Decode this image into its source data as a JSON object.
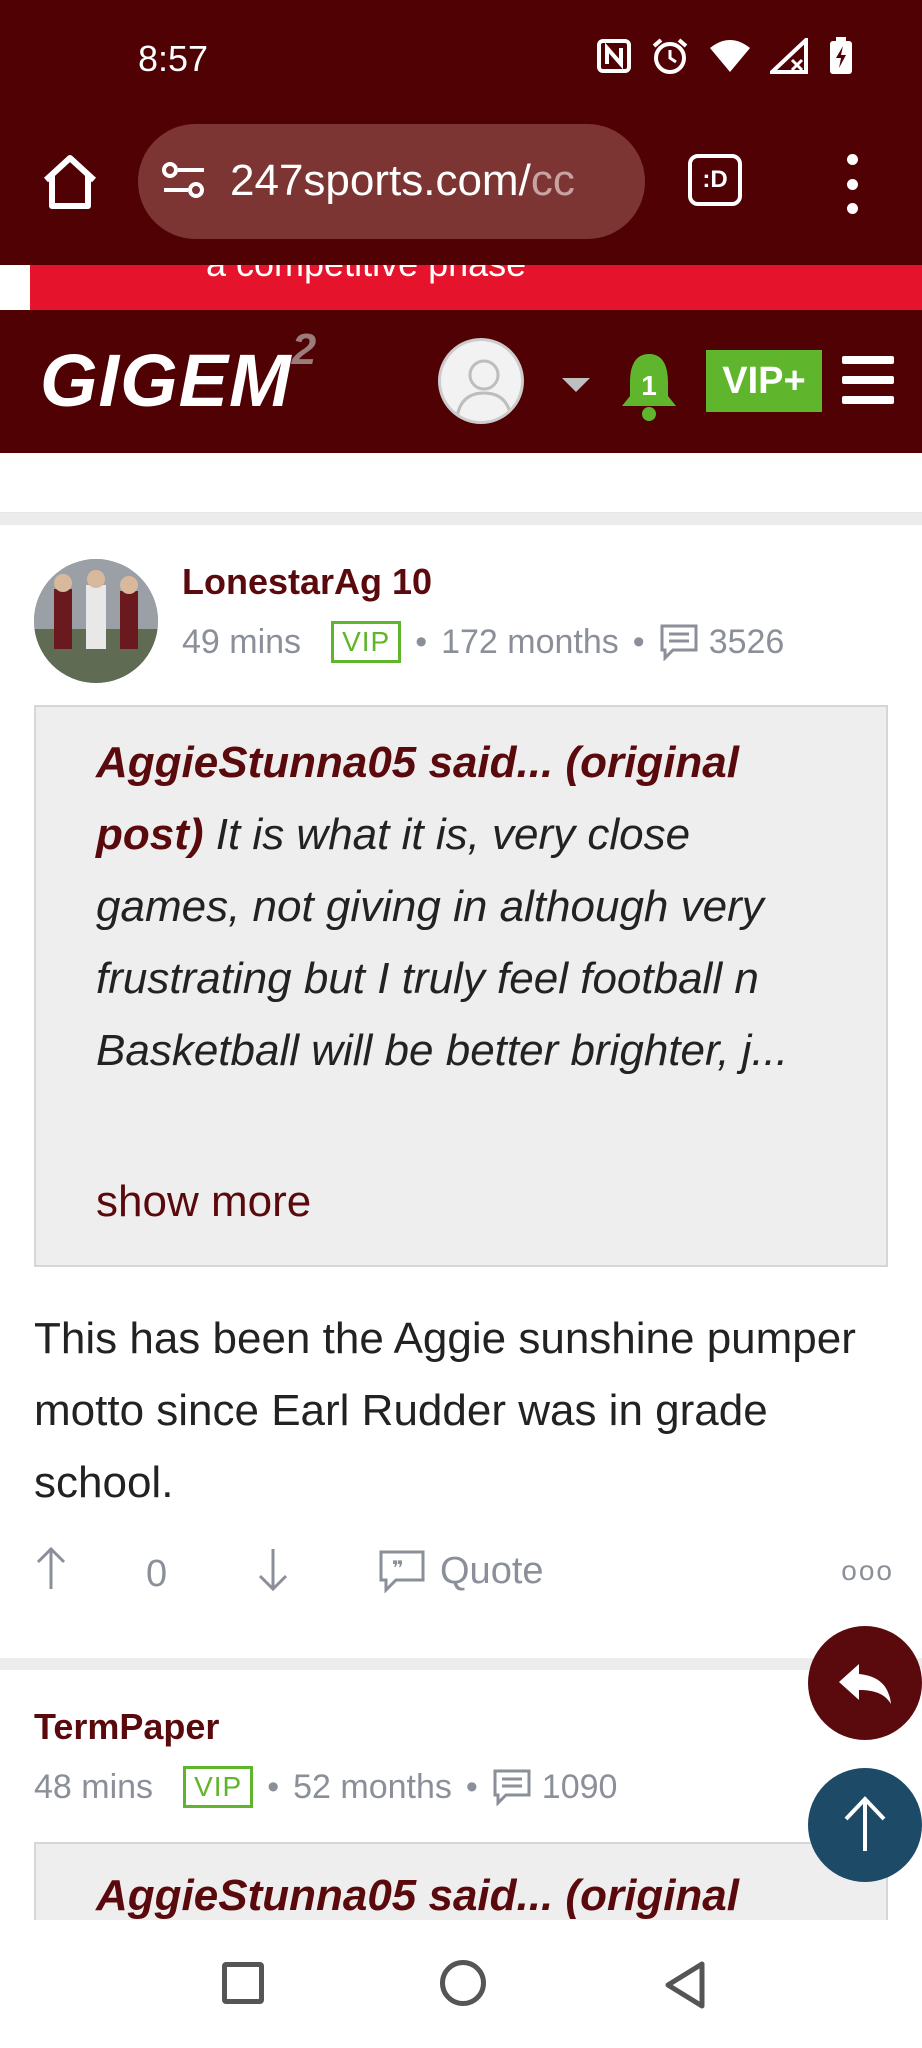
{
  "status_bar": {
    "time": "8:57"
  },
  "browser": {
    "url_main": "247sports.com/",
    "url_fade": "cc",
    "tab_label": ":D"
  },
  "promo": {
    "text": "a competitive phase"
  },
  "site_header": {
    "logo_text": "GIGEM",
    "logo_super": "2",
    "notification_count": "1",
    "vip_label": "VIP+"
  },
  "post": {
    "username": "LonestarAg 10",
    "time": "49 mins",
    "badge": "VIP",
    "tenure": "172 months",
    "post_count": "3526",
    "quote": {
      "author": "AggieStunna05 said... (original post)",
      "text": " It is what it is, very close games, not giving in although very frustrating but I truly feel football n Basketball will be better brighter, j...",
      "show_more": "show more"
    },
    "body": "This has been the Aggie sunshine pumper motto since Earl Rudder was in grade school.",
    "vote_count": "0",
    "quote_label": "Quote",
    "more_label": "ooo"
  },
  "post2": {
    "username": "TermPaper",
    "time": "48 mins",
    "badge": "VIP",
    "tenure": "52 months",
    "post_count": "1090",
    "quote_author": "AggieStunna05 said... (original"
  },
  "colors": {
    "maroon": "#4f0103",
    "vip_green": "#5fb52b",
    "promo_red": "#e5132b",
    "scroll_top_blue": "#1d4a66"
  }
}
